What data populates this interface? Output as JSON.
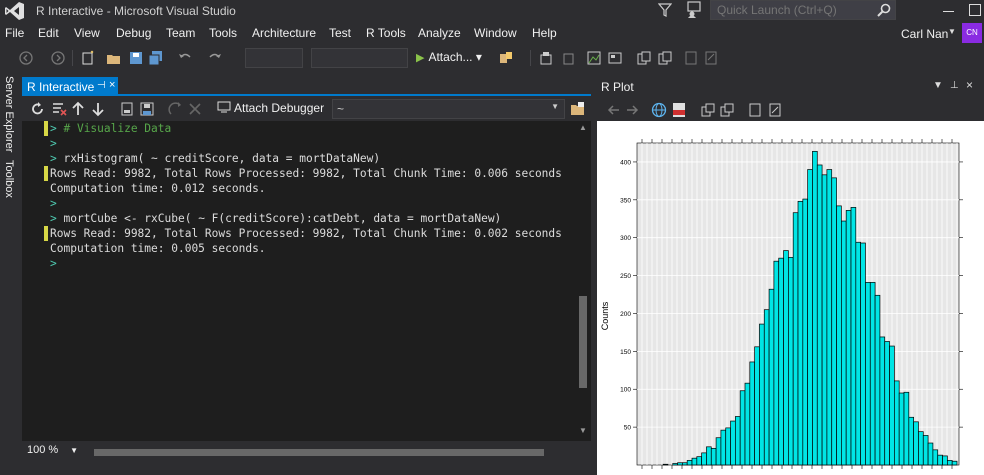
{
  "window": {
    "title": "R Interactive - Microsoft Visual Studio",
    "quick_launch_placeholder": "Quick Launch (Ctrl+Q)",
    "user_name": "Carl Nan",
    "user_initials": "CN"
  },
  "menu": [
    "File",
    "Edit",
    "View",
    "Debug",
    "Team",
    "Tools",
    "Architecture",
    "Test",
    "R Tools",
    "Analyze",
    "Window",
    "Help"
  ],
  "toolbar": {
    "attach_label": "Attach..."
  },
  "side_tabs": [
    "Server Explorer",
    "Toolbox"
  ],
  "r_interactive": {
    "tab_label": "R Interactive",
    "attach_debugger_label": "Attach Debugger",
    "combo_value": "~",
    "zoom": "100 %",
    "lines": [
      {
        "prompt": ">",
        "text": " # Visualize Data",
        "kind": "comment"
      },
      {
        "prompt": ">",
        "text": "",
        "kind": "input"
      },
      {
        "prompt": ">",
        "text": " rxHistogram( ~ creditScore, data = mortDataNew)",
        "kind": "input"
      },
      {
        "prompt": "",
        "text": "Rows Read: 9982, Total Rows Processed: 9982, Total Chunk Time: 0.006 seconds",
        "kind": "output"
      },
      {
        "prompt": "",
        "text": "Computation time: 0.012 seconds.",
        "kind": "output"
      },
      {
        "prompt": ">",
        "text": "",
        "kind": "input"
      },
      {
        "prompt": ">",
        "text": " mortCube <- rxCube( ~ F(creditScore):catDebt, data = mortDataNew)",
        "kind": "input"
      },
      {
        "prompt": "",
        "text": "Rows Read: 9982, Total Rows Processed: 9982, Total Chunk Time: 0.002 seconds",
        "kind": "output"
      },
      {
        "prompt": "",
        "text": "Computation time: 0.005 seconds.",
        "kind": "output"
      },
      {
        "prompt": ">",
        "text": "",
        "kind": "input"
      }
    ]
  },
  "r_plot": {
    "title": "R Plot"
  },
  "colors": {
    "accent": "#007acc",
    "bar_fill": "#00e5e5",
    "panel_bg": "#e6e6e6"
  },
  "chart_data": {
    "type": "bar",
    "ylabel": "Counts",
    "ylim": [
      0,
      425
    ],
    "yticks": [
      50,
      100,
      150,
      200,
      250,
      300,
      350,
      400
    ],
    "grid": true,
    "values": [
      0,
      0,
      0,
      0,
      0,
      1,
      0,
      2,
      3,
      3,
      6,
      9,
      11,
      16,
      24,
      22,
      36,
      46,
      49,
      58,
      64,
      98,
      108,
      136,
      156,
      186,
      205,
      232,
      269,
      273,
      283,
      274,
      333,
      348,
      351,
      390,
      414,
      396,
      383,
      390,
      379,
      342,
      322,
      336,
      340,
      294,
      293,
      241,
      241,
      224,
      169,
      163,
      157,
      111,
      95,
      96,
      63,
      57,
      44,
      39,
      29,
      20,
      13,
      12,
      6,
      5
    ]
  }
}
